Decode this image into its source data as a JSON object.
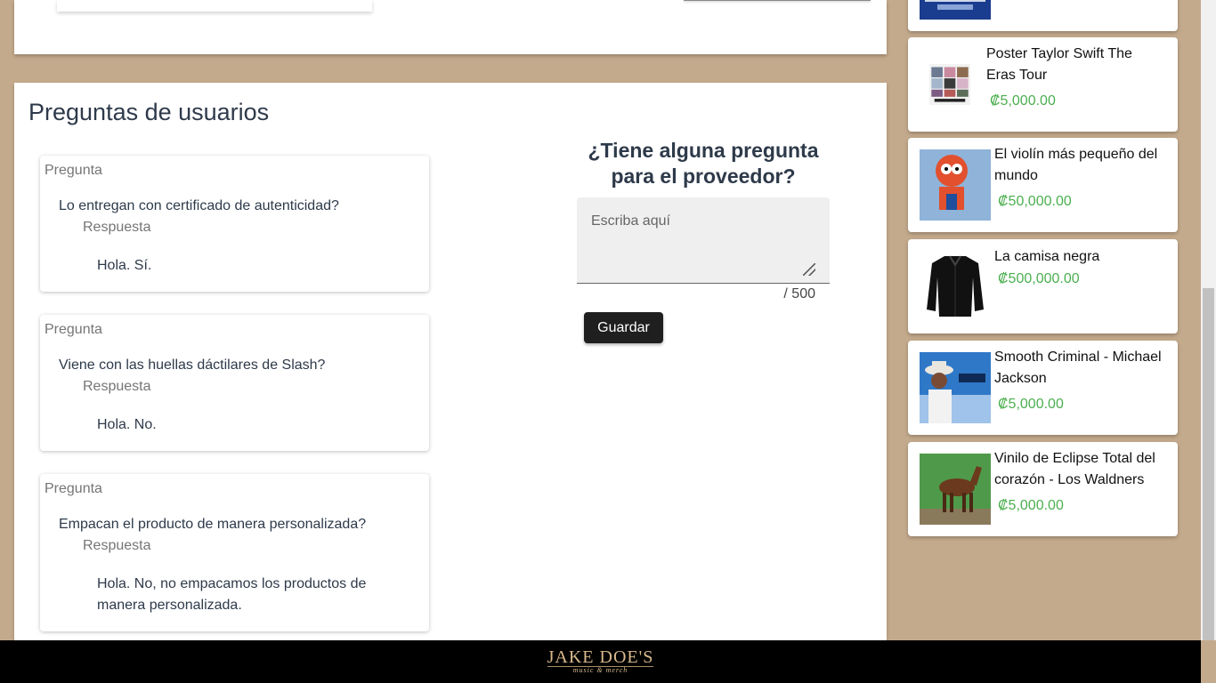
{
  "questions_section": {
    "title": "Preguntas de usuarios",
    "items": [
      {
        "question_label": "Pregunta",
        "question": "Lo entregan con certificado de autenticidad?",
        "answer_label": "Respuesta",
        "answer": "Hola. Sí."
      },
      {
        "question_label": "Pregunta",
        "question": "Viene con las huellas dáctilares de Slash?",
        "answer_label": "Respuesta",
        "answer": "Hola. No."
      },
      {
        "question_label": "Pregunta",
        "question": "Empacan el producto de manera personalizada?",
        "answer_label": "Respuesta",
        "answer": "Hola. No, no empacamos los productos de manera personalizada."
      }
    ]
  },
  "ask_form": {
    "title": "¿Tiene alguna pregunta para el proveedor?",
    "placeholder": "Escriba aquí",
    "counter": "/ 500",
    "save_label": "Guardar"
  },
  "related_products": [
    {
      "name": "Poster Taylor Swift The Eras Tour",
      "price": "₡5,000.00"
    },
    {
      "name": "El violín más pequeño del mundo",
      "price": "₡50,000.00"
    },
    {
      "name": "La camisa negra",
      "price": "₡500,000.00"
    },
    {
      "name": "Smooth Criminal - Michael Jackson",
      "price": "₡5,000.00"
    },
    {
      "name": "Vinilo de Eclipse Total del corazón - Los Waldners",
      "price": "₡5,000.00"
    }
  ],
  "footer": {
    "brand": "JAKE DOE'S",
    "tagline": "music & merch"
  },
  "colors": {
    "page_background": "#c4aa8c",
    "price_green": "#4caf50",
    "button_dark": "#1f1f1f"
  }
}
